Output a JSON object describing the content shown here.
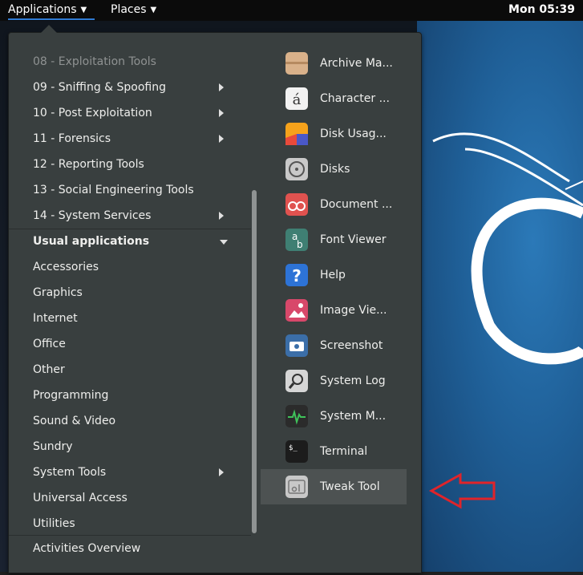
{
  "topbar": {
    "applications_label": "Applications",
    "places_label": "Places",
    "clock": "Mon 05:39"
  },
  "menu": {
    "categories": [
      {
        "label": "08 - Exploitation Tools",
        "submenu": false,
        "state": "dim"
      },
      {
        "label": "09 - Sniffing & Spoofing",
        "submenu": true
      },
      {
        "label": "10 - Post Exploitation",
        "submenu": true
      },
      {
        "label": "11 - Forensics",
        "submenu": true
      },
      {
        "label": "12 - Reporting Tools",
        "submenu": false
      },
      {
        "label": "13 - Social Engineering Tools",
        "submenu": false
      },
      {
        "label": "14 - System Services",
        "submenu": true
      },
      {
        "label": "Usual applications",
        "submenu": false,
        "expanded": true
      },
      {
        "label": "Accessories"
      },
      {
        "label": "Graphics"
      },
      {
        "label": "Internet"
      },
      {
        "label": "Office"
      },
      {
        "label": "Other"
      },
      {
        "label": "Programming"
      },
      {
        "label": "Sound & Video"
      },
      {
        "label": "Sundry"
      },
      {
        "label": "System Tools",
        "submenu": true
      },
      {
        "label": "Universal Access"
      },
      {
        "label": "Utilities"
      }
    ],
    "activities_overview": "Activities Overview",
    "apps": [
      {
        "label": "Archive Ma...",
        "icon": "archive-icon",
        "color": "#d9b18a"
      },
      {
        "label": "Character ...",
        "icon": "character-map-icon",
        "color": "#f2f2f2"
      },
      {
        "label": "Disk Usag...",
        "icon": "disk-usage-icon",
        "color": "#f6a21b"
      },
      {
        "label": "Disks",
        "icon": "disks-icon",
        "color": "#c9c9c9"
      },
      {
        "label": "Document ...",
        "icon": "document-viewer-icon",
        "color": "#e0524f"
      },
      {
        "label": "Font Viewer",
        "icon": "font-viewer-icon",
        "color": "#3f7f73"
      },
      {
        "label": "Help",
        "icon": "help-icon",
        "color": "#2d73d6"
      },
      {
        "label": "Image Vie...",
        "icon": "image-viewer-icon",
        "color": "#d8486a"
      },
      {
        "label": "Screenshot",
        "icon": "screenshot-icon",
        "color": "#3b6ea8"
      },
      {
        "label": "System Log",
        "icon": "system-log-icon",
        "color": "#d6d6d6"
      },
      {
        "label": "System M...",
        "icon": "system-monitor-icon",
        "color": "#2b2b2b"
      },
      {
        "label": "Terminal",
        "icon": "terminal-icon",
        "color": "#1c1c1c"
      },
      {
        "label": "Tweak Tool",
        "icon": "tweak-tool-icon",
        "color": "#c8c8c8",
        "selected": true
      }
    ]
  },
  "annotation": {
    "icon": "red-arrow-icon",
    "color": "#e0242a"
  }
}
